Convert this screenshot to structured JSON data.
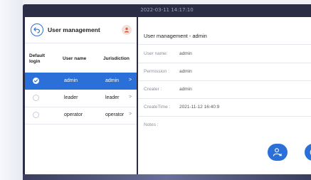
{
  "status_bar": {
    "datetime": "2022-03-11 14:17:10"
  },
  "left_panel": {
    "title": "User management",
    "columns": [
      "Default login",
      "User name",
      "Jurisdiction"
    ],
    "rows": [
      {
        "user_name": "admin",
        "jurisdiction": "admin",
        "selected": true
      },
      {
        "user_name": "leader",
        "jurisdiction": "leader",
        "selected": false
      },
      {
        "user_name": "operator",
        "jurisdiction": "operator",
        "selected": false
      }
    ],
    "chevron": ">"
  },
  "right_panel": {
    "title": "User management - admin",
    "fields": [
      {
        "label": "User name:",
        "value": "admin"
      },
      {
        "label": "Permission :",
        "value": "admin"
      },
      {
        "label": "Creater :",
        "value": "admin"
      },
      {
        "label": "CreateTime :",
        "value": "2021-11-12 16:40:9"
      },
      {
        "label": "Notes :",
        "value": ""
      }
    ]
  },
  "icons": {
    "back": "back-arrow-icon",
    "user": "user-icon",
    "delete_user": "user-remove-icon",
    "reset_password": "lock-reset-icon"
  },
  "colors": {
    "accent": "#2b6fd8",
    "device_frame": "#2a2d44"
  }
}
